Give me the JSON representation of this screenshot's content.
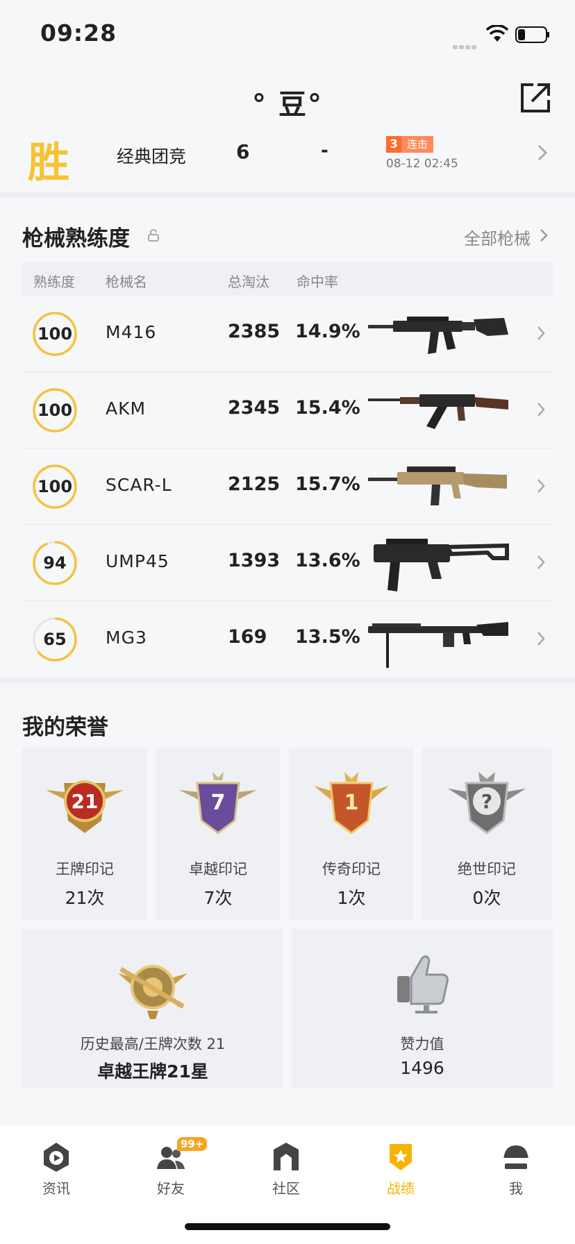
{
  "status_bar": {
    "time": "09:28"
  },
  "header": {
    "title": "°  豆°"
  },
  "last_match": {
    "result": "胜",
    "mode": "经典团竞",
    "kills": "6",
    "placement": "-",
    "streak_count": "3",
    "streak_label": "连击",
    "datetime": "08-12 02:45"
  },
  "mastery": {
    "title": "枪械熟练度",
    "all_link": "全部枪械",
    "columns": [
      "熟练度",
      "枪械名",
      "总淘汰",
      "命中率"
    ],
    "guns": [
      {
        "level": "100",
        "level_value": 100,
        "name": "M416",
        "kills": "2385",
        "accuracy": "14.9%"
      },
      {
        "level": "100",
        "level_value": 100,
        "name": "AKM",
        "kills": "2345",
        "accuracy": "15.4%"
      },
      {
        "level": "100",
        "level_value": 100,
        "name": "SCAR-L",
        "kills": "2125",
        "accuracy": "15.7%"
      },
      {
        "level": "94",
        "level_value": 94,
        "name": "UMP45",
        "kills": "1393",
        "accuracy": "13.6%"
      },
      {
        "level": "65",
        "level_value": 65,
        "name": "MG3",
        "kills": "169",
        "accuracy": "13.5%"
      }
    ]
  },
  "honors": {
    "title": "我的荣誉",
    "marks": [
      {
        "label": "王牌印记",
        "count": "21次",
        "medal_text": "21"
      },
      {
        "label": "卓越印记",
        "count": "7次",
        "medal_text": "7"
      },
      {
        "label": "传奇印记",
        "count": "1次",
        "medal_text": "1"
      },
      {
        "label": "绝世印记",
        "count": "0次",
        "medal_text": "?"
      }
    ],
    "highest": {
      "label": "历史最高/王牌次数 21",
      "value": "卓越王牌21星"
    },
    "likes": {
      "label": "赞力值",
      "value": "1496"
    }
  },
  "tabs": [
    {
      "label": "资讯",
      "icon": "news-icon"
    },
    {
      "label": "好友",
      "icon": "friends-icon",
      "badge": "99+"
    },
    {
      "label": "社区",
      "icon": "community-icon"
    },
    {
      "label": "战绩",
      "icon": "record-icon",
      "active": true
    },
    {
      "label": "我",
      "icon": "helmet-icon"
    }
  ],
  "colors": {
    "accent": "#f5b400",
    "streak": "#ff6b2c",
    "ring": "#f5c23a"
  }
}
